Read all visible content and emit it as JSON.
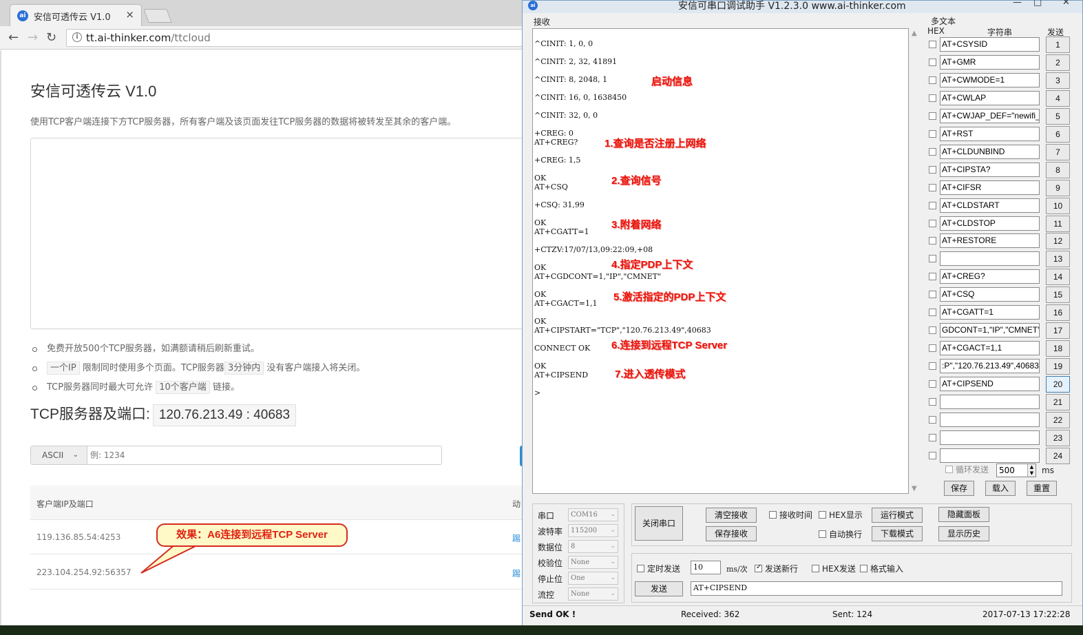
{
  "browser": {
    "tab_title": "安信可透传云 V1.0",
    "tab_favicon": "ai-logo-icon",
    "url_host": "tt.ai-thinker.com",
    "url_path": "/ttcloud"
  },
  "page": {
    "title": "安信可透传云 V1.0",
    "description": "使用TCP客户端连接下方TCP服务器，所有客户端及该页面发往TCP服务器的数据将被转发至其余的客户端。",
    "notes": {
      "n1": "免费开放500个TCP服务器，如满额请稍后刷新重试。",
      "n2_code1": "一个IP",
      "n2_mid": "限制同时使用多个页面。TCP服务器",
      "n2_code2": "3分钟内",
      "n2_end": "没有客户端接入将关闭。",
      "n3_start": "TCP服务器同时最大可允许",
      "n3_code": "10个客户端",
      "n3_end": "链接。"
    },
    "server_label": "TCP服务器及端口:",
    "server_addr": "120.76.213.49 : 40683",
    "mode_select": "ASCII",
    "input_placeholder": "例: 1234",
    "table": {
      "col_client": "客户端IP及端口",
      "col_action": "动",
      "rows": [
        {
          "client": "119.136.85.54:4253",
          "action": "踢"
        },
        {
          "client": "223.104.254.92:56357",
          "action": "踢"
        }
      ]
    },
    "callout": "效果：A6连接到远程TCP Server"
  },
  "serial": {
    "title": "安信可串口调试助手 V1.2.3.0     www.ai-thinker.com",
    "window_buttons": {
      "minimize": "—",
      "maximize": "□",
      "close": "✕"
    },
    "recv_label": "接收",
    "recv_lines": {
      "l1": "^CINIT: 1, 0, 0",
      "l2": "^CINIT: 2, 32, 41891",
      "l3": "^CINIT: 8, 2048, 1",
      "l4": "^CINIT: 16, 0, 1638450",
      "l5": "^CINIT: 32, 0, 0",
      "l6": "+CREG: 0",
      "l7": "AT+CREG?",
      "l8": "+CREG: 1,5",
      "l9": "OK",
      "l10": "AT+CSQ",
      "l11": "+CSQ: 31,99",
      "l12": "OK",
      "l13": "AT+CGATT=1",
      "l14": "+CTZV:17/07/13,09:22:09,+08",
      "l15": "OK",
      "l16": "AT+CGDCONT=1,\"IP\",\"CMNET\"",
      "l17": "OK",
      "l18": "AT+CGACT=1,1",
      "l19": "OK",
      "l20": "AT+CIPSTART=\"TCP\",\"120.76.213.49\",40683",
      "l21": "CONNECT OK",
      "l22": "OK",
      "l23": "AT+CIPSEND",
      "l24": ">"
    },
    "annotations": {
      "a0": "启动信息",
      "a1": "1.查询是否注册上网络",
      "a2": "2.查询信号",
      "a3": "3.附着网络",
      "a4": "4.指定PDP上下文",
      "a5": "5.激活指定的PDP上下文",
      "a6": "6.连接到远程TCP Server",
      "a7": "7.进入透传模式"
    },
    "multi": {
      "title": "多文本",
      "col_hex": "HEX",
      "col_str": "字符串",
      "col_send": "发送",
      "rows": [
        {
          "text": "AT+CSYSID",
          "btn": "1"
        },
        {
          "text": "AT+GMR",
          "btn": "2"
        },
        {
          "text": "AT+CWMODE=1",
          "btn": "3"
        },
        {
          "text": "AT+CWLAP",
          "btn": "4"
        },
        {
          "text": "AT+CWJAP_DEF=\"newifi_",
          "btn": "5"
        },
        {
          "text": "AT+RST",
          "btn": "6"
        },
        {
          "text": "AT+CLDUNBIND",
          "btn": "7"
        },
        {
          "text": "AT+CIPSTA?",
          "btn": "8"
        },
        {
          "text": "AT+CIFSR",
          "btn": "9"
        },
        {
          "text": "AT+CLDSTART",
          "btn": "10"
        },
        {
          "text": "AT+CLDSTOP",
          "btn": "11"
        },
        {
          "text": "AT+RESTORE",
          "btn": "12"
        },
        {
          "text": "",
          "btn": "13"
        },
        {
          "text": "AT+CREG?",
          "btn": "14"
        },
        {
          "text": "AT+CSQ",
          "btn": "15"
        },
        {
          "text": "AT+CGATT=1",
          "btn": "16"
        },
        {
          "text": "GDCONT=1,\"IP\",\"CMNET\"",
          "btn": "17"
        },
        {
          "text": "AT+CGACT=1,1",
          "btn": "18"
        },
        {
          "text": ":P\",\"120.76.213.49\",40683",
          "btn": "19"
        },
        {
          "text": "AT+CIPSEND",
          "btn": "20"
        },
        {
          "text": "",
          "btn": "21"
        },
        {
          "text": "",
          "btn": "22"
        },
        {
          "text": "",
          "btn": "23"
        },
        {
          "text": "",
          "btn": "24"
        }
      ],
      "loop_label": "循环发送",
      "loop_value": "500",
      "loop_unit": "ms",
      "save": "保存",
      "load": "载入",
      "reset": "重置"
    },
    "port": {
      "port_label": "串口",
      "port_value": "COM16",
      "baud_label": "波特率",
      "baud_value": "115200",
      "data_label": "数据位",
      "data_value": "8",
      "parity_label": "校验位",
      "parity_value": "None",
      "stop_label": "停止位",
      "stop_value": "One",
      "flow_label": "流控",
      "flow_value": "None"
    },
    "controls": {
      "close_port": "关闭串口",
      "clear_recv": "清空接收",
      "save_recv": "保存接收",
      "recv_time": "接收时间",
      "hex_display": "HEX显示",
      "auto_newline": "自动换行",
      "run_mode": "运行模式",
      "download_mode": "下载模式",
      "hide_panel": "隐藏面板",
      "show_history": "显示历史"
    },
    "send": {
      "timed_send": "定时发送",
      "interval": "10",
      "interval_unit": "ms/次",
      "send_newline": "发送新行",
      "hex_send": "HEX发送",
      "format_input": "格式输入",
      "send_button": "发送",
      "send_text": "AT+CIPSEND"
    },
    "status": {
      "state": "Send OK !",
      "received": "Received: 362",
      "sent": "Sent: 124",
      "datetime": "2017-07-13 17:22:28"
    }
  }
}
